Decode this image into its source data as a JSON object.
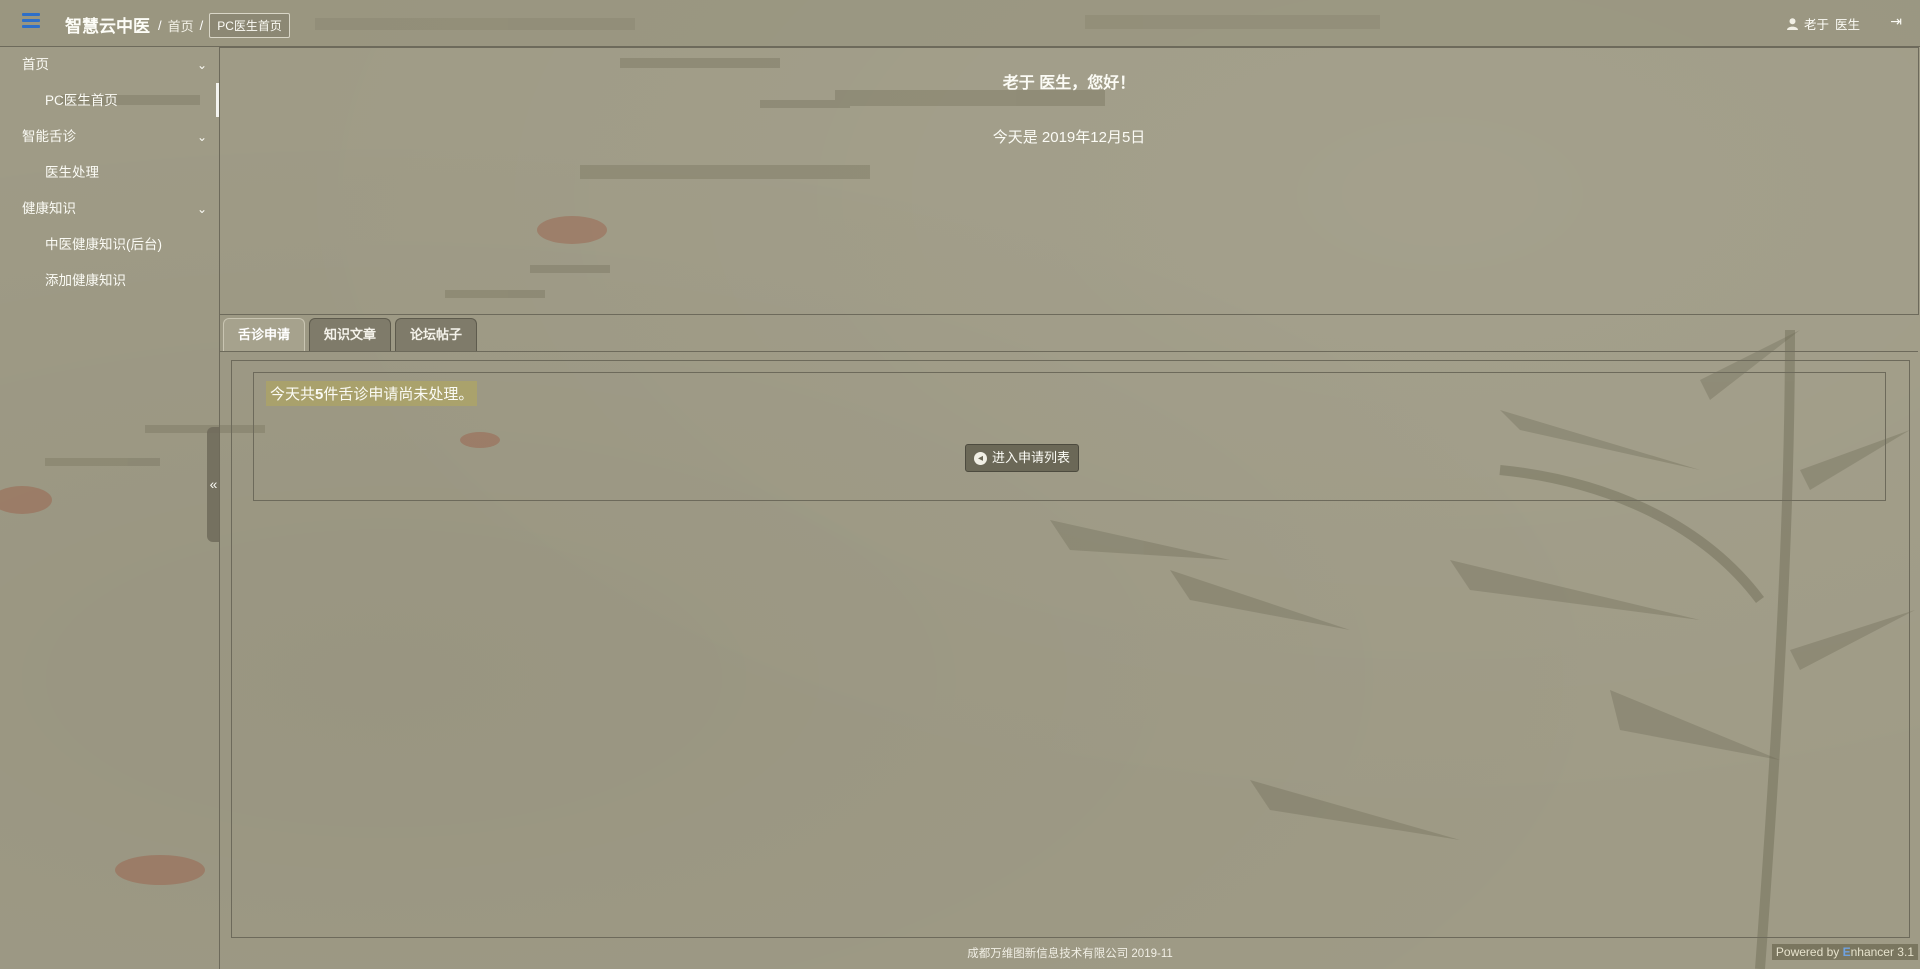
{
  "app": {
    "brand": "智慧云中医"
  },
  "breadcrumb": {
    "separator": "/",
    "home": "首页",
    "current": "PC医生首页"
  },
  "user": {
    "name": "老于",
    "role": "医生"
  },
  "icons": {
    "menu": "hamburger-icon",
    "user": "user-icon",
    "logout": "logout-icon",
    "chevron": "chevron-down-icon",
    "collapse": "double-chevron-left-icon",
    "arrow": "circle-arrow-left-icon"
  },
  "sidebar": {
    "groups": [
      {
        "label": "首页",
        "items": [
          "PC医生首页"
        ]
      },
      {
        "label": "智能舌诊",
        "items": [
          "医生处理"
        ]
      },
      {
        "label": "健康知识",
        "items": [
          "中医健康知识(后台)",
          "添加健康知识"
        ]
      }
    ]
  },
  "welcome": {
    "greeting": "老于 医生，您好！",
    "date_prefix": "今天是",
    "date": "2019年12月5日"
  },
  "tabs": [
    "舌诊申请",
    "知识文章",
    "论坛帖子"
  ],
  "notice": {
    "prefix": "今天共",
    "count": "5",
    "suffix": "件舌诊申请尚未处理。",
    "button": "进入申请列表"
  },
  "footer": {
    "copyright": "成都万维图新信息技术有限公司 2019-11",
    "powered_prefix": "Powered by ",
    "powered_e": "E",
    "powered_rest": "nhancer 3.1"
  },
  "colors": {
    "background": "#9f9b86",
    "accent": "#2f6fc8",
    "highlight": "#b4aa5a"
  }
}
